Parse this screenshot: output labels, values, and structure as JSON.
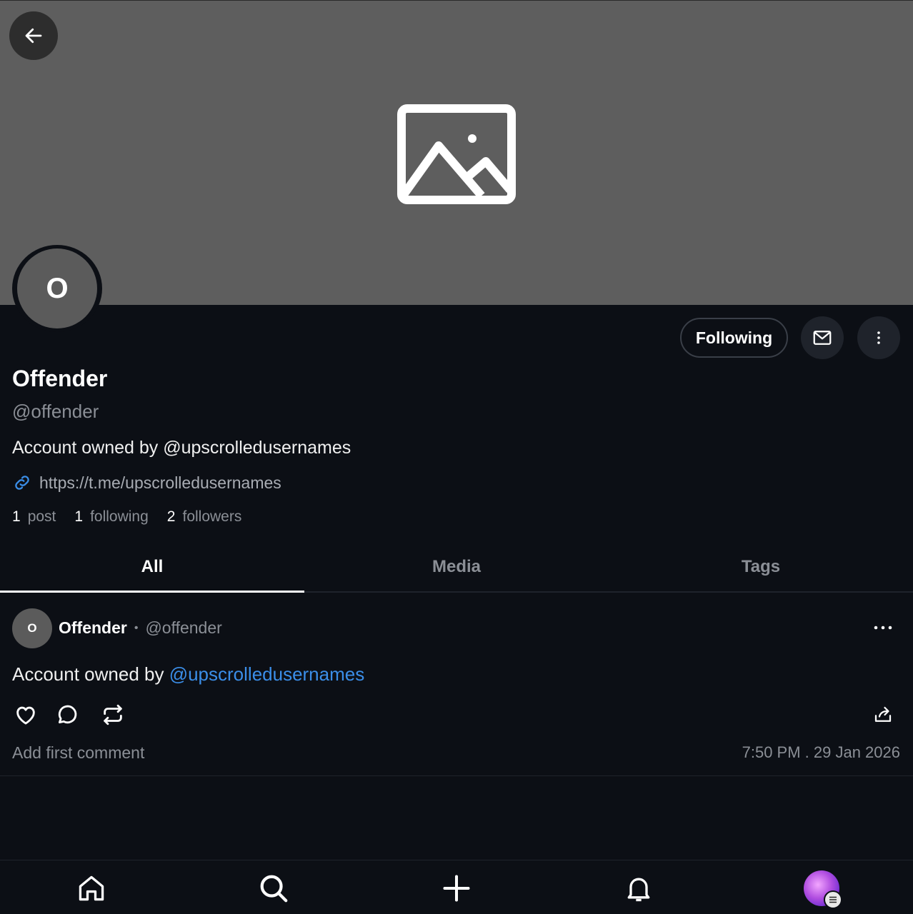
{
  "profile": {
    "avatar_initial": "O",
    "display_name": "Offender",
    "handle": "@offender",
    "bio": "Account owned by @upscrolledusernames",
    "link": "https://t.me/upscrolledusernames",
    "stats": [
      {
        "num": "1",
        "label": "post"
      },
      {
        "num": "1",
        "label": "following"
      },
      {
        "num": "2",
        "label": "followers"
      }
    ],
    "following_label": "Following"
  },
  "tabs": [
    {
      "label": "All",
      "active": true
    },
    {
      "label": "Media",
      "active": false
    },
    {
      "label": "Tags",
      "active": false
    }
  ],
  "post": {
    "avatar_initial": "O",
    "name": "Offender",
    "separator": "•",
    "handle": "@offender",
    "text_prefix": "Account owned by ",
    "mention": "@upscrolledusernames",
    "comment_prompt": "Add first comment",
    "timestamp": "7:50 PM . 29 Jan 2026"
  },
  "colors": {
    "background": "#0c0f15",
    "banner": "#5e5e5e",
    "accent_link": "#3b8ee8",
    "muted_text": "#8b8f96"
  },
  "icons": [
    "back-arrow-icon",
    "image-placeholder-icon",
    "mail-icon",
    "vertical-more-icon",
    "link-icon",
    "horizontal-more-icon",
    "heart-icon",
    "comment-icon",
    "repost-icon",
    "share-icon",
    "home-icon",
    "search-icon",
    "plus-icon",
    "bell-icon"
  ]
}
